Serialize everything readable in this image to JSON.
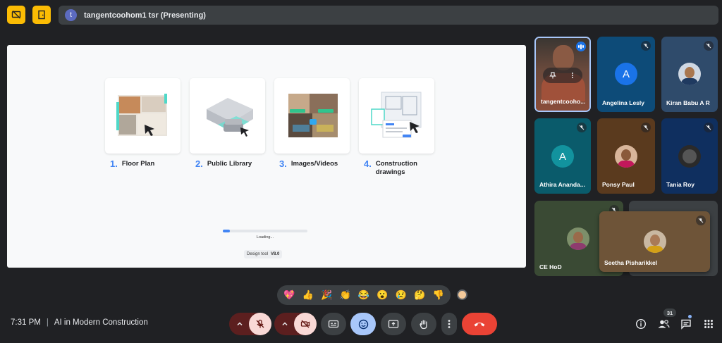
{
  "header": {
    "presenter_initial": "t",
    "presenter_label": "tangentcoohom1 tsr (Presenting)"
  },
  "presentation": {
    "cards": [
      {
        "num": "1.",
        "label": "Floor Plan"
      },
      {
        "num": "2.",
        "label": "Public Library"
      },
      {
        "num": "3.",
        "label": "Images/Videos"
      },
      {
        "num": "4.",
        "label": "Construction drawings"
      }
    ],
    "loading_text": "Loading...",
    "loading_progress": 0.08,
    "design_tool_label": "Design tool",
    "design_tool_version": "V8.0"
  },
  "participants": [
    {
      "name": "tangentcooho...",
      "kind": "video",
      "bg": "#5a3a30"
    },
    {
      "name": "Angelina Lesly",
      "kind": "letter",
      "letter": "A",
      "bg": "#0d4b78"
    },
    {
      "name": "Kiran Babu A R",
      "kind": "photo",
      "bg": "#2f4b6b"
    },
    {
      "name": "Athira Ananda...",
      "kind": "letter",
      "letter": "A",
      "bg": "#0a5b6b"
    },
    {
      "name": "Ponsy Paul",
      "kind": "photo",
      "bg": "#5a3a1e"
    },
    {
      "name": "Tania Roy",
      "kind": "photo",
      "bg": "#0f2f5f"
    },
    {
      "name": "CE HoD",
      "kind": "photo",
      "bg": "#3a4a34"
    },
    {
      "name": "Seetha Pisharikkel",
      "kind": "photo",
      "bg": "#6e5438"
    }
  ],
  "reactions": [
    "💖",
    "👍",
    "🎉",
    "👏",
    "😂",
    "😮",
    "😢",
    "🤔",
    "👎"
  ],
  "footer": {
    "time": "7:31 PM",
    "separator": "|",
    "meeting_title": "AI in Modern Construction",
    "participant_count": "31"
  },
  "colors": {
    "accent": "#fbbc04",
    "blue": "#4285f4",
    "end_call": "#ea4335",
    "active_control": "#a8c7fa"
  }
}
